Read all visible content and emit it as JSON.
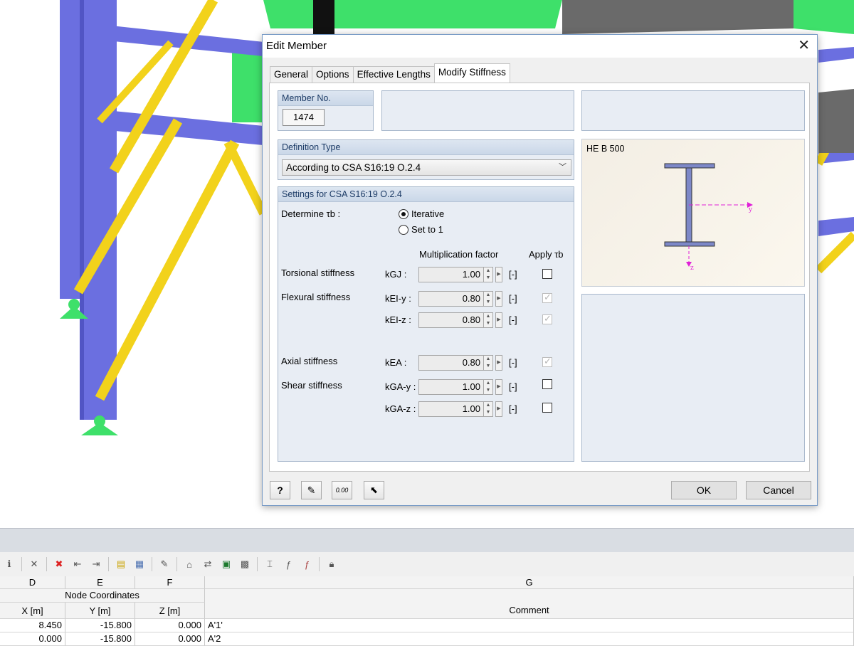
{
  "dialog": {
    "title": "Edit Member",
    "tabs": [
      "General",
      "Options",
      "Effective Lengths",
      "Modify Stiffness"
    ],
    "member_no_label": "Member No.",
    "member_no": "1474",
    "definition_type_label": "Definition Type",
    "definition_type_value": "According to CSA S16:19 O.2.4",
    "settings_label": "Settings for CSA S16:19 O.2.4",
    "determine_label": "Determine τb :",
    "radio_iterative": "Iterative",
    "radio_set_to_1": "Set to 1",
    "radio_selected": "Iterative",
    "col_mult_factor": "Multiplication factor",
    "col_apply": "Apply τb",
    "unit": "[-]",
    "rows": [
      {
        "label": "Torsional stiffness",
        "sym": "kGJ :",
        "value": "1.00",
        "apply": false,
        "apply_enabled": true
      },
      {
        "label": "Flexural stiffness",
        "sym": "kEI-y :",
        "value": "0.80",
        "apply": true,
        "apply_enabled": false
      },
      {
        "label": "",
        "sym": "kEI-z :",
        "value": "0.80",
        "apply": true,
        "apply_enabled": false
      },
      {
        "label": "Axial stiffness",
        "sym": "kEA :",
        "value": "0.80",
        "apply": true,
        "apply_enabled": false
      },
      {
        "label": "Shear stiffness",
        "sym": "kGA-y :",
        "value": "1.00",
        "apply": false,
        "apply_enabled": true
      },
      {
        "label": "",
        "sym": "kGA-z :",
        "value": "1.00",
        "apply": false,
        "apply_enabled": true
      }
    ],
    "section_name": "HE B 500",
    "axis_y": "y",
    "axis_z": "z",
    "ok": "OK",
    "cancel": "Cancel"
  },
  "table": {
    "col_letters": [
      "D",
      "E",
      "F",
      "G"
    ],
    "group_header": "Node Coordinates",
    "headers": [
      "X [m]",
      "Y [m]",
      "Z [m]",
      "Comment"
    ],
    "rows": [
      [
        "8.450",
        "-15.800",
        "0.000",
        "A'1'"
      ],
      [
        "0.000",
        "-15.800",
        "0.000",
        "A'2"
      ]
    ]
  },
  "colors": {
    "member_blue": "#6b6fe0",
    "brace_yellow": "#f2d21b",
    "panel_green": "#3ee06a",
    "dialog_accent": "#1c3b66"
  }
}
